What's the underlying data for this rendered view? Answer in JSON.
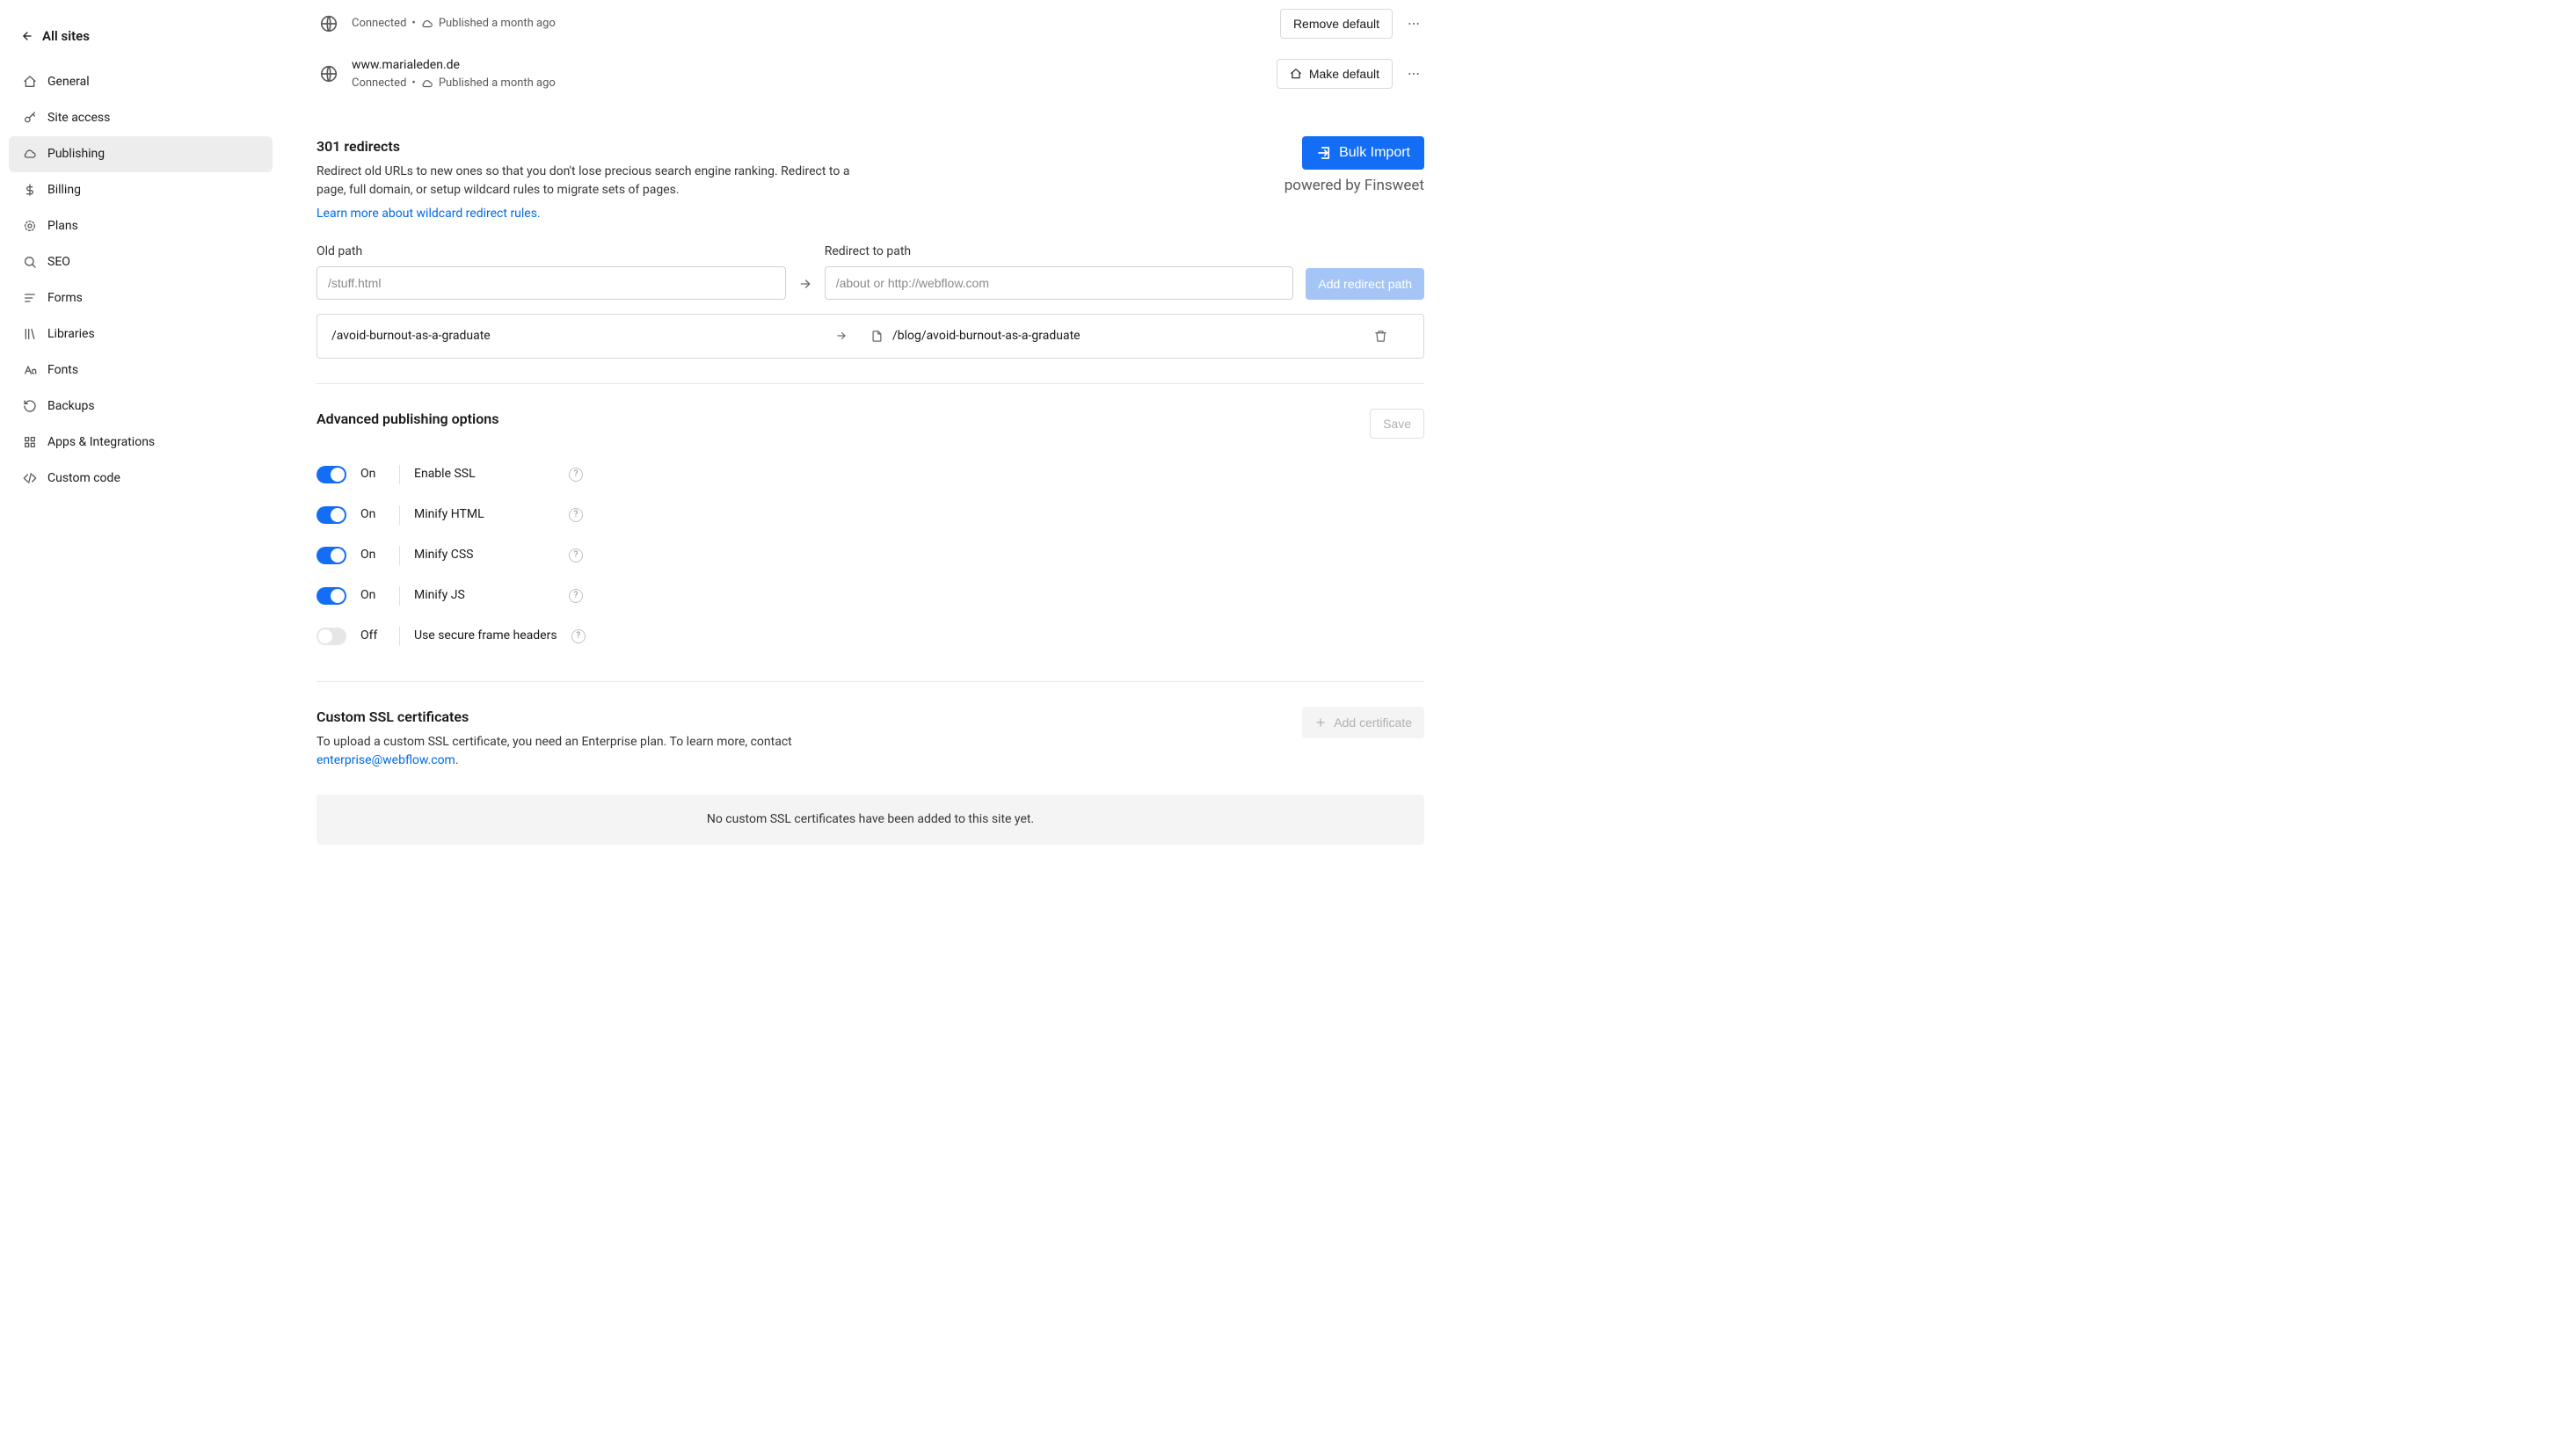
{
  "sidebar": {
    "back_label": "All sites",
    "items": [
      {
        "label": "General"
      },
      {
        "label": "Site access"
      },
      {
        "label": "Publishing",
        "active": true
      },
      {
        "label": "Billing"
      },
      {
        "label": "Plans"
      },
      {
        "label": "SEO"
      },
      {
        "label": "Forms"
      },
      {
        "label": "Libraries"
      },
      {
        "label": "Fonts"
      },
      {
        "label": "Backups"
      },
      {
        "label": "Apps & Integrations"
      },
      {
        "label": "Custom code"
      }
    ]
  },
  "domains": [
    {
      "name": "",
      "status": "Connected",
      "published": "Published a month ago",
      "action": "Remove default"
    },
    {
      "name": "www.marialeden.de",
      "status": "Connected",
      "published": "Published a month ago",
      "action": "Make default"
    }
  ],
  "redirects": {
    "title": "301 redirects",
    "desc": "Redirect old URLs to new ones so that you don't lose precious search engine ranking. Redirect to a page, full domain, or setup wildcard rules to migrate sets of pages.",
    "learn_more": "Learn more about wildcard redirect rules.",
    "bulk_import": "Bulk Import",
    "powered_by": "powered by Finsweet",
    "old_path_label": "Old path",
    "old_path_placeholder": "/stuff.html",
    "redirect_to_label": "Redirect to path",
    "redirect_to_placeholder": "/about or http://webflow.com",
    "add_button": "Add redirect path",
    "rows": [
      {
        "from": "/avoid-burnout-as-a-graduate",
        "to": "/blog/avoid-burnout-as-a-graduate"
      }
    ]
  },
  "advanced": {
    "title": "Advanced publishing options",
    "save": "Save",
    "options": [
      {
        "state": "On",
        "on": true,
        "label": "Enable SSL"
      },
      {
        "state": "On",
        "on": true,
        "label": "Minify HTML"
      },
      {
        "state": "On",
        "on": true,
        "label": "Minify CSS"
      },
      {
        "state": "On",
        "on": true,
        "label": "Minify JS"
      },
      {
        "state": "Off",
        "on": false,
        "label": "Use secure frame headers"
      }
    ]
  },
  "ssl": {
    "title": "Custom SSL certificates",
    "desc_a": "To upload a custom SSL certificate, you need an Enterprise plan. To learn more, contact ",
    "email": "enterprise@webflow.com",
    "desc_b": ".",
    "add_button": "Add certificate",
    "empty": "No custom SSL certificates have been added to this site yet."
  }
}
